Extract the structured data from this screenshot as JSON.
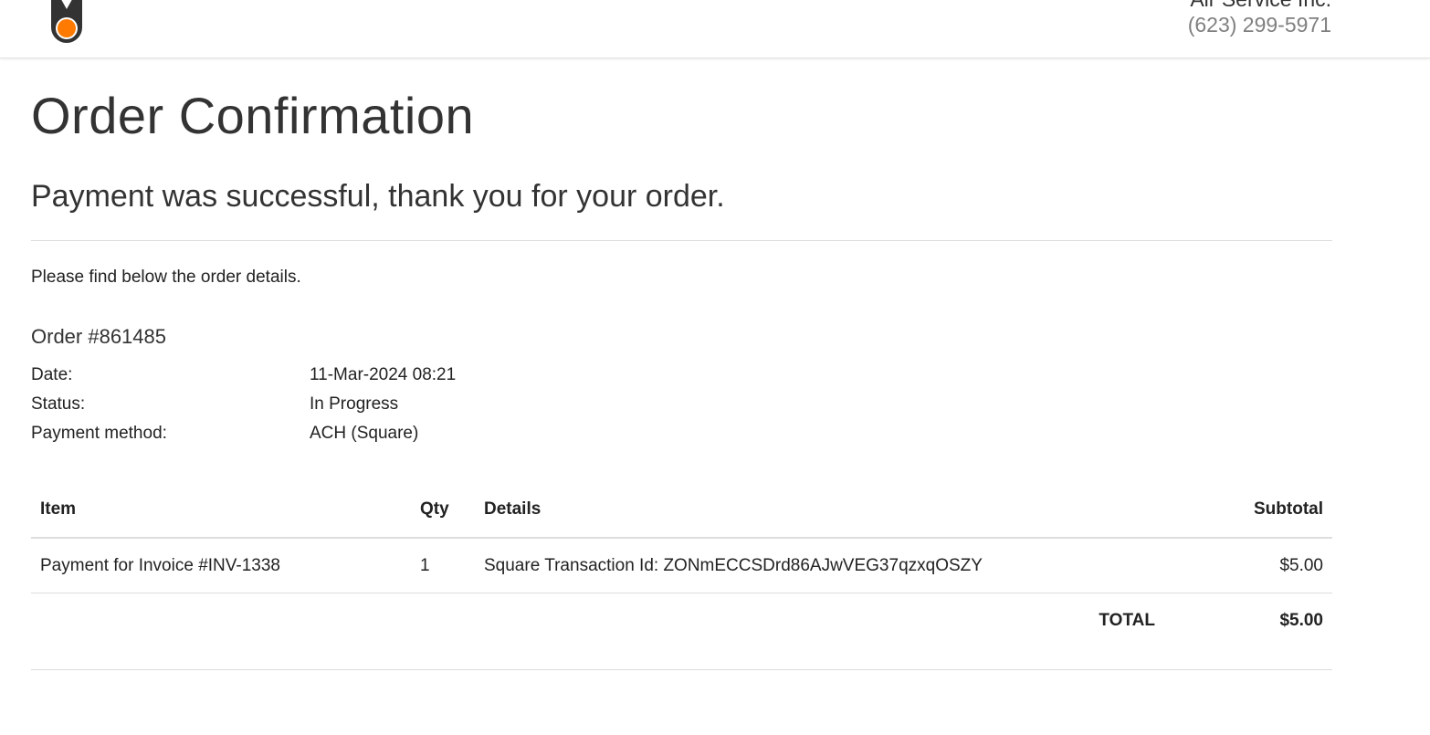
{
  "header": {
    "company_name": "Air Service Inc.",
    "phone": "(623) 299-5971",
    "logo_icon": "orange-dot-logo-icon",
    "accent_color": "#ff7a00"
  },
  "page": {
    "title": "Order Confirmation",
    "success_message": "Payment was successful, thank you for your order.",
    "intro": "Please find below the order details."
  },
  "order": {
    "number_label": "Order #861485",
    "fields": [
      {
        "label": "Date:",
        "value": "11-Mar-2024 08:21"
      },
      {
        "label": "Status:",
        "value": "In Progress"
      },
      {
        "label": "Payment method:",
        "value": "ACH (Square)"
      }
    ]
  },
  "table": {
    "headers": {
      "item": "Item",
      "qty": "Qty",
      "details": "Details",
      "subtotal": "Subtotal"
    },
    "rows": [
      {
        "item": "Payment for Invoice #INV-1338",
        "qty": "1",
        "details": "Square Transaction Id: ZONmECCSDrd86AJwVEG37qzxqOSZY",
        "subtotal": "$5.00"
      }
    ],
    "total_label": "TOTAL",
    "total_value": "$5.00"
  }
}
